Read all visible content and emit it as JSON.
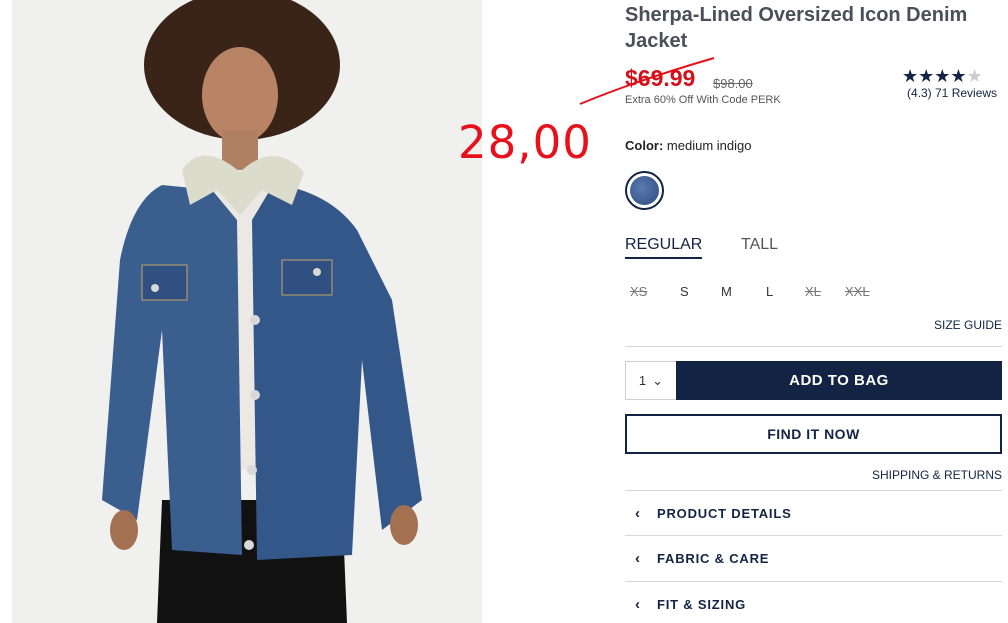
{
  "product": {
    "title": "Sherpa-Lined Oversized Icon Denim Jacket",
    "sale_price": "$69.99",
    "original_price": "$98.00",
    "promo": "Extra 60% Off With Code PERK",
    "rating_stars": "★★★★",
    "rating_half": "★",
    "rating": 4.3,
    "reviews": "(4.3) 71 Reviews"
  },
  "annotation": {
    "price": "28,00"
  },
  "color": {
    "label": "Color:",
    "value": "medium indigo",
    "swatch_color": "#3b5b92"
  },
  "fit": {
    "tabs": [
      "REGULAR",
      "TALL"
    ],
    "selected": "REGULAR"
  },
  "sizes": [
    {
      "label": "XS",
      "available": false
    },
    {
      "label": "S",
      "available": true
    },
    {
      "label": "M",
      "available": true
    },
    {
      "label": "L",
      "available": true
    },
    {
      "label": "XL",
      "available": false
    },
    {
      "label": "XXL",
      "available": false
    }
  ],
  "links": {
    "size_guide": "SIZE GUIDE",
    "shipping": "SHIPPING & RETURNS"
  },
  "purchase": {
    "quantity": "1",
    "add_to_bag": "ADD TO BAG",
    "find_it_now": "FIND IT NOW"
  },
  "accordions": [
    {
      "label": "PRODUCT DETAILS"
    },
    {
      "label": "FABRIC & CARE"
    },
    {
      "label": "FIT & SIZING"
    }
  ],
  "colors": {
    "navy": "#122344",
    "sale_red": "#d3111b",
    "annotation_red": "#e8101a"
  }
}
